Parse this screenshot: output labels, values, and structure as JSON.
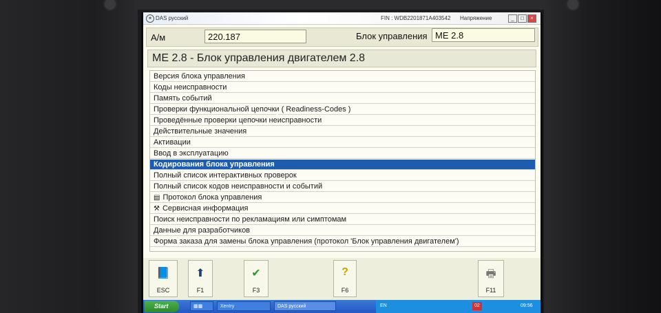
{
  "window": {
    "app_title": "DAS русский",
    "fin": "FIN : WDB2201871A403542",
    "voltage_label": "Напряжение",
    "min_label": "_",
    "max_label": "□",
    "close_label": "×"
  },
  "vehicle": {
    "am_label": "А/м",
    "am_value": "220.187",
    "ecu_label": "Блок управления",
    "ecu_value": "ME 2.8"
  },
  "module_title": "ME 2.8 - Блок управления двигателем 2.8",
  "menu": {
    "items": [
      {
        "label": "Версия блока управления",
        "icon": ""
      },
      {
        "label": "Коды неисправности",
        "icon": ""
      },
      {
        "label": "Память событий",
        "icon": ""
      },
      {
        "label": "Проверки функциональной цепочки ( Readiness-Codes )",
        "icon": ""
      },
      {
        "label": "Проведённые проверки цепочки неисправности",
        "icon": ""
      },
      {
        "label": "Действительные значения",
        "icon": ""
      },
      {
        "label": "Активации",
        "icon": ""
      },
      {
        "label": "Ввод в эксплуатацию",
        "icon": ""
      },
      {
        "label": "Кодирования блока управления",
        "icon": ""
      },
      {
        "label": "Полный список интерактивных проверок",
        "icon": ""
      },
      {
        "label": "Полный список кодов неисправности и событий",
        "icon": ""
      },
      {
        "label": "Протокол блока управления",
        "icon": "document-icon"
      },
      {
        "label": "Сервисная информация",
        "icon": "wrench-icon"
      },
      {
        "label": "Поиск неисправности по рекламациям или симптомам",
        "icon": ""
      },
      {
        "label": "Данные для разработчиков",
        "icon": ""
      },
      {
        "label": "Форма заказа для замены блока управления (протокол 'Блок управления двигателем')",
        "icon": ""
      }
    ],
    "selected_index": 8
  },
  "fkeys": [
    {
      "label": "ESC",
      "icon": "book-exit-icon"
    },
    {
      "label": "F1",
      "icon": "arrow-up-icon"
    },
    {
      "label": "F3",
      "icon": "checkmark-icon"
    },
    {
      "label": "F6",
      "icon": "question-icon"
    },
    {
      "label": "F11",
      "icon": "printer-icon"
    }
  ],
  "taskbar": {
    "start_label": "Start",
    "task1": "Xentry",
    "task2": "DAS русский",
    "lang": "EN",
    "badge": "02",
    "clock": "09:56"
  },
  "colors": {
    "selection": "#1d5cae",
    "taskbar": "#2457c2"
  }
}
